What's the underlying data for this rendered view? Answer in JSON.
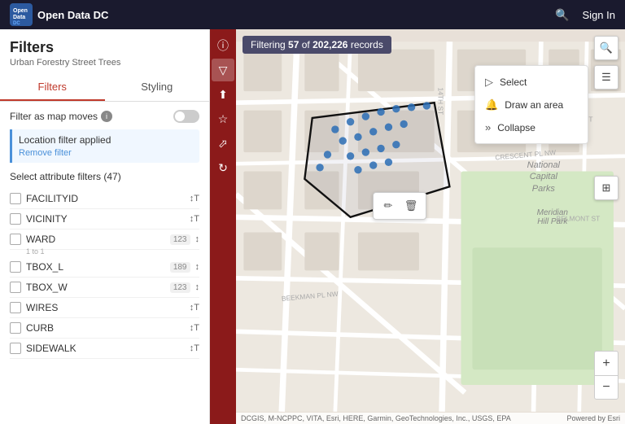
{
  "header": {
    "title": "Open Data DC",
    "search_label": "Search",
    "signin_label": "Sign In"
  },
  "sidebar": {
    "title": "Filters",
    "subtitle": "Urban Forestry Street Trees",
    "tabs": [
      {
        "id": "filters",
        "label": "Filters",
        "active": true
      },
      {
        "id": "styling",
        "label": "Styling",
        "active": false
      }
    ],
    "filter_as_map_moves": {
      "label": "Filter as map moves",
      "enabled": false
    },
    "location_filter": {
      "text": "Location filter applied",
      "remove_link": "Remove filter"
    },
    "attr_filters_title": "Select attribute filters (47)",
    "filters": [
      {
        "id": "FACILITYID",
        "label": "FACILITYID",
        "badge": "",
        "type": "text",
        "sub": ""
      },
      {
        "id": "VICINITY",
        "label": "VICINITY",
        "badge": "",
        "type": "text",
        "sub": ""
      },
      {
        "id": "WARD",
        "label": "WARD",
        "badge": "123",
        "type": "number",
        "sub": "1to1"
      },
      {
        "id": "TBOX_L",
        "label": "TBOX_L",
        "badge": "189",
        "type": "number",
        "sub": ""
      },
      {
        "id": "TBOX_W",
        "label": "TBOX_W",
        "badge": "123",
        "type": "number",
        "sub": ""
      },
      {
        "id": "WIRES",
        "label": "WIRES",
        "badge": "",
        "type": "text",
        "sub": ""
      },
      {
        "id": "CURB",
        "label": "CURB",
        "badge": "",
        "type": "text",
        "sub": ""
      },
      {
        "id": "SIDEWALK",
        "label": "SIDEWALK",
        "badge": "",
        "type": "text",
        "sub": ""
      }
    ]
  },
  "map": {
    "filter_count_text": "Filtering",
    "filter_current": "57",
    "filter_of": "of",
    "filter_total": "202,226",
    "filter_records": "records",
    "select_panel": {
      "items": [
        {
          "icon": "▷",
          "label": "Select"
        },
        {
          "icon": "🔔",
          "label": "Draw an area"
        },
        {
          "icon": "»",
          "label": "Collapse"
        }
      ]
    },
    "labels": {
      "national_capital_parks": "National\nCapital\nParks",
      "meridian_hill_park": "Meridian\nHill Park"
    },
    "attribution": "DCGIS, M-NCPPC, VITA, Esri, HERE, Garmin, GeoTechnologies, Inc., USGS, EPA",
    "powered_by": "Powered by Esri"
  }
}
